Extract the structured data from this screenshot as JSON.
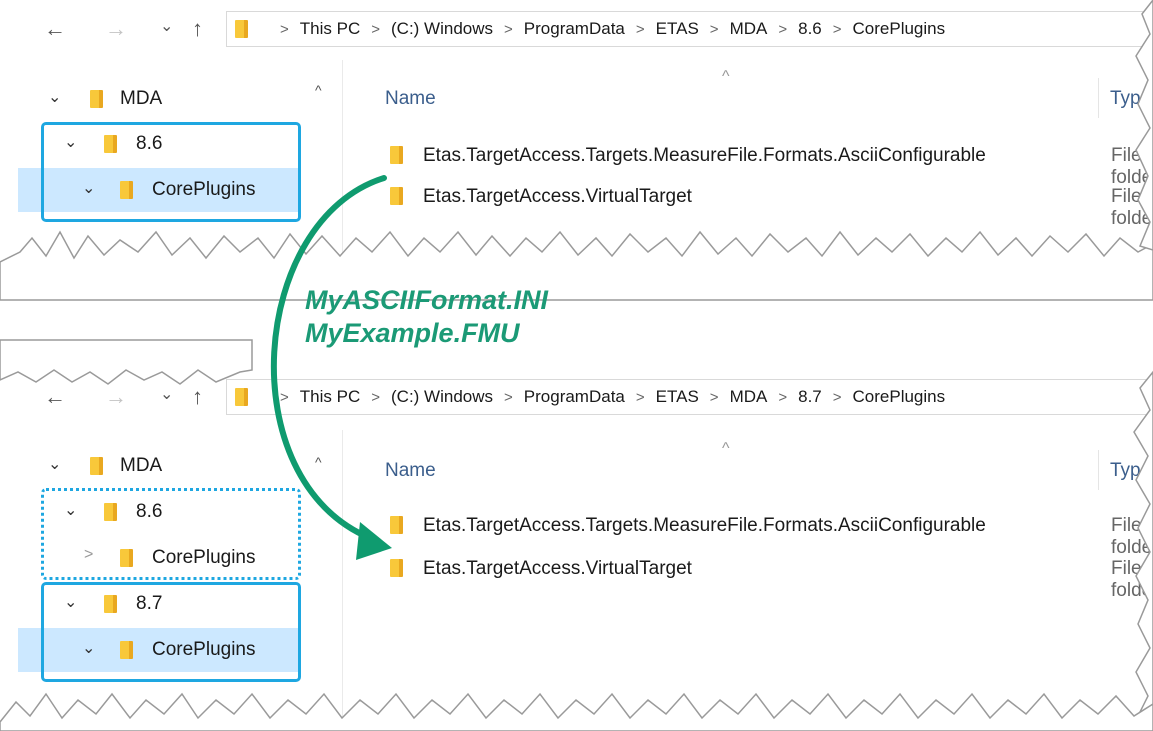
{
  "top_window": {
    "nav": {
      "back": "←",
      "forward": "→",
      "recent": "⌄",
      "up": "↑"
    },
    "breadcrumb": [
      "This PC",
      "(C:) Windows",
      "ProgramData",
      "ETAS",
      "MDA",
      "8.6",
      "CorePlugins"
    ],
    "tree": [
      {
        "label": "MDA",
        "chevron": "expanded"
      },
      {
        "label": "8.6",
        "chevron": "expanded"
      },
      {
        "label": "CorePlugins",
        "chevron": "expanded",
        "selected": true
      }
    ],
    "columns": {
      "name": "Name",
      "type": "Type",
      "sort_indicator": "^"
    },
    "files": [
      {
        "name": "Etas.TargetAccess.Targets.MeasureFile.Formats.AsciiConfigurable",
        "type": "File folder"
      },
      {
        "name": "Etas.TargetAccess.VirtualTarget",
        "type": "File folder"
      }
    ]
  },
  "annotation": {
    "lines": [
      "MyASCIIFormat.INI",
      "MyExample.FMU"
    ],
    "color": "#1b9a76"
  },
  "bottom_window": {
    "nav": {
      "back": "←",
      "forward": "→",
      "recent": "⌄",
      "up": "↑"
    },
    "breadcrumb": [
      "This PC",
      "(C:) Windows",
      "ProgramData",
      "ETAS",
      "MDA",
      "8.7",
      "CorePlugins"
    ],
    "tree": [
      {
        "label": "MDA",
        "chevron": "expanded"
      },
      {
        "label": "8.6",
        "chevron": "expanded"
      },
      {
        "label": "CorePlugins",
        "chevron": "collapsed"
      },
      {
        "label": "8.7",
        "chevron": "expanded"
      },
      {
        "label": "CorePlugins",
        "chevron": "expanded",
        "selected": true
      }
    ],
    "columns": {
      "name": "Name",
      "type": "Type",
      "sort_indicator": "^"
    },
    "files": [
      {
        "name": "Etas.TargetAccess.Targets.MeasureFile.Formats.AsciiConfigurable",
        "type": "File folder"
      },
      {
        "name": "Etas.TargetAccess.VirtualTarget",
        "type": "File folder"
      }
    ]
  },
  "highlight_color": "#1ea7e1",
  "icons": [
    "back-arrow-icon",
    "forward-arrow-icon",
    "recent-dropdown-icon",
    "up-arrow-icon",
    "folder-icon",
    "chevron-right-icon",
    "chevron-down-icon",
    "curved-arrow-icon"
  ]
}
